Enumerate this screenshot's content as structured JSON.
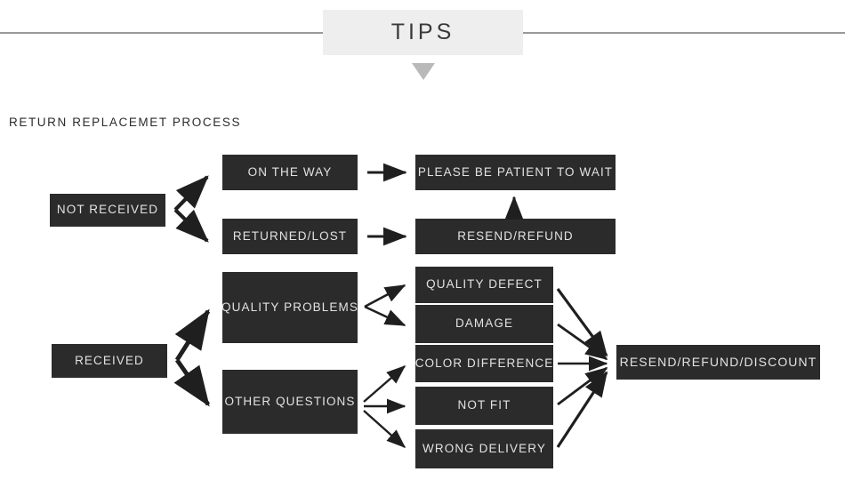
{
  "header": {
    "banner_label": "TIPS",
    "caret_icon": "triangle-down-icon"
  },
  "section": {
    "title": "RETURN REPLACEMET PROCESS"
  },
  "colors": {
    "node_background": "#2b2b2b",
    "node_text": "#e2e2e2",
    "banner_background": "#eeeeee",
    "page_background": "#ffffff",
    "divider": "#6e6e6e",
    "caret": "#b9b9b9",
    "arrow": "#1f1f1f"
  },
  "flowchart": {
    "branches": [
      {
        "id": "not-received",
        "label": "NOT RECEIVED",
        "children": [
          {
            "id": "on-the-way",
            "label": "ON THE WAY",
            "outcome": "please-wait"
          },
          {
            "id": "returned-lost",
            "label": "RETURNED/LOST",
            "outcome": "resend-refund"
          }
        ]
      },
      {
        "id": "received",
        "label": "RECEIVED",
        "children": [
          {
            "id": "quality-problems",
            "label": "QUALITY PROBLEMS",
            "reasons": [
              {
                "id": "quality-defect",
                "label": "QUALITY DEFECT"
              },
              {
                "id": "damage",
                "label": "DAMAGE"
              }
            ]
          },
          {
            "id": "other-questions",
            "label": "OTHER QUESTIONS",
            "reasons": [
              {
                "id": "color-difference",
                "label": "COLOR DIFFERENCE"
              },
              {
                "id": "not-fit",
                "label": "NOT FIT"
              },
              {
                "id": "wrong-delivery",
                "label": "WRONG DELIVERY"
              }
            ]
          }
        ]
      }
    ],
    "outcomes": [
      {
        "id": "please-wait",
        "label": "PLEASE BE PATIENT TO WAIT"
      },
      {
        "id": "resend-refund",
        "label": "RESEND/REFUND"
      },
      {
        "id": "final",
        "label": "RESEND/REFUND/DISCOUNT"
      }
    ]
  }
}
